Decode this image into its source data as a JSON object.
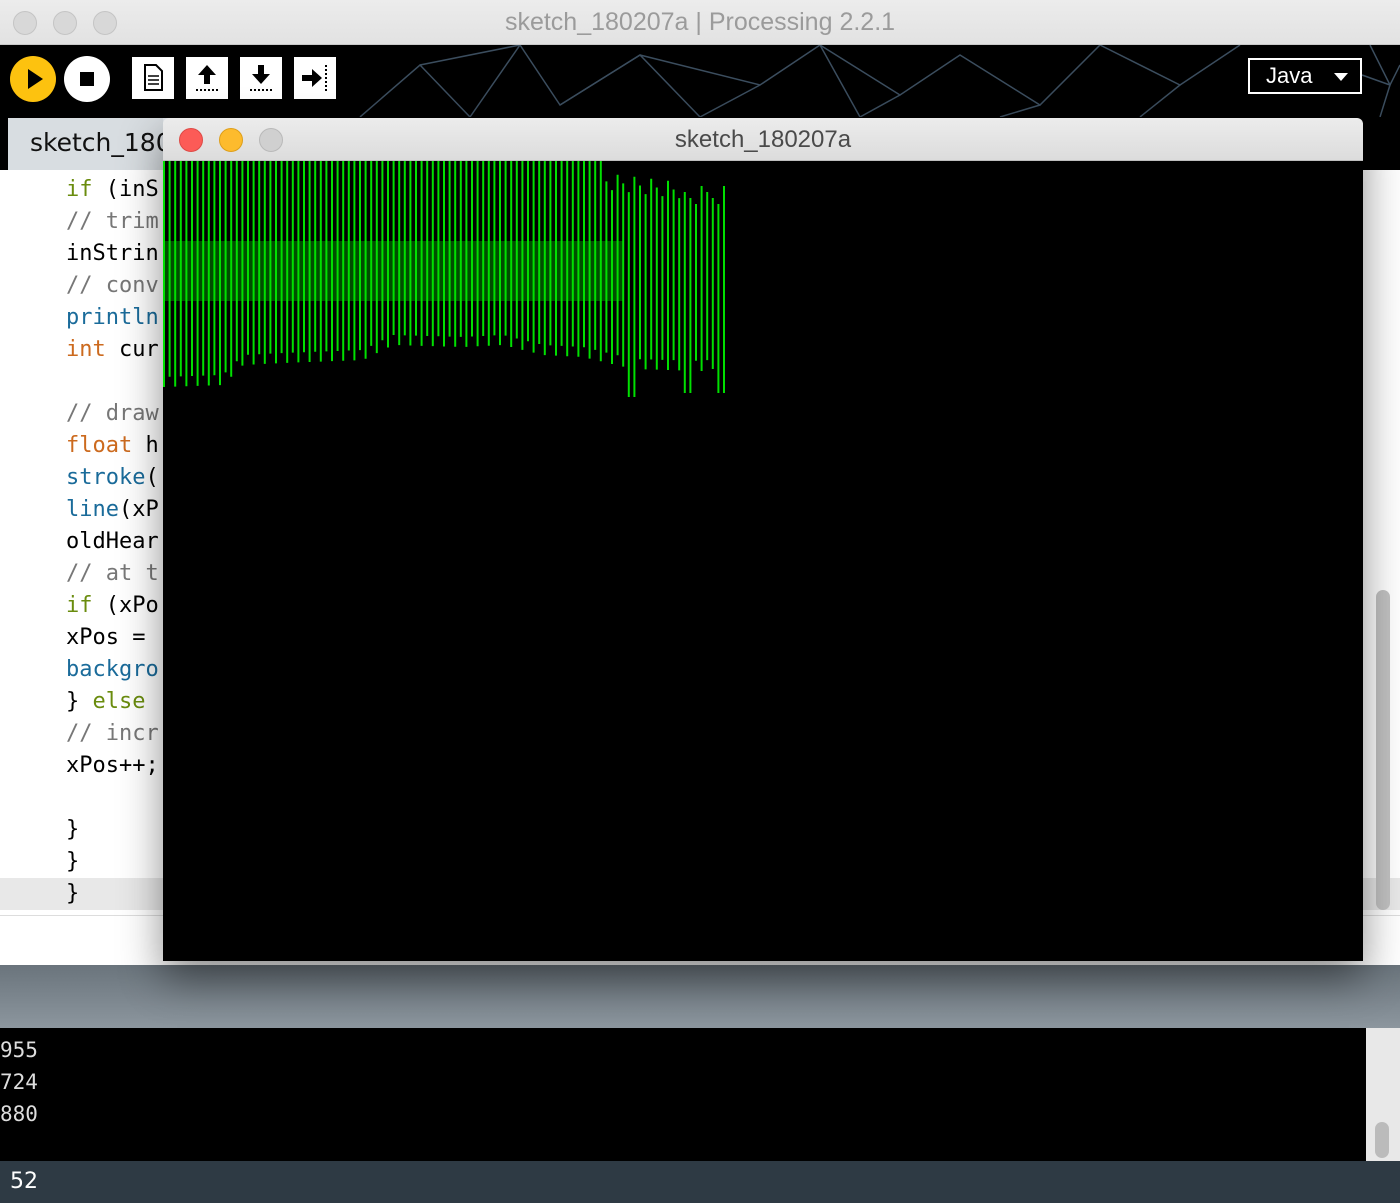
{
  "window": {
    "title": "sketch_180207a | Processing 2.2.1"
  },
  "toolbar": {
    "buttons": [
      {
        "name": "run-button",
        "icon": "play-icon"
      },
      {
        "name": "stop-button",
        "icon": "stop-icon"
      },
      {
        "name": "new-button",
        "icon": "new-file-icon"
      },
      {
        "name": "open-button",
        "icon": "upload-arrow-icon"
      },
      {
        "name": "save-button",
        "icon": "download-arrow-icon"
      },
      {
        "name": "export-button",
        "icon": "export-arrow-icon"
      }
    ],
    "mode_label": "Java",
    "run_color": "#fdc20f"
  },
  "tabs": [
    {
      "label": "sketch_180"
    }
  ],
  "editor": {
    "lines": [
      {
        "text": "if (inS",
        "kind": "mixed",
        "kw": "if",
        "rest": " (inS"
      },
      {
        "text": "// trim",
        "kind": "comment"
      },
      {
        "text": "inStrin",
        "kind": "plain"
      },
      {
        "text": "// conv",
        "kind": "comment"
      },
      {
        "text": "println",
        "kind": "blue"
      },
      {
        "text": "int cur",
        "kind": "mixed-orange",
        "kw": "int",
        "rest": " cur"
      },
      {
        "text": "",
        "kind": "plain"
      },
      {
        "text": "// draw",
        "kind": "comment"
      },
      {
        "text": "float h",
        "kind": "mixed-orange",
        "kw": "float",
        "rest": " h"
      },
      {
        "text": "stroke(",
        "kind": "mixed-blue",
        "kw": "stroke",
        "rest": "("
      },
      {
        "text": "line(xP",
        "kind": "mixed-blue",
        "kw": "line",
        "rest": "(xP"
      },
      {
        "text": "oldHear",
        "kind": "plain"
      },
      {
        "text": "// at t",
        "kind": "comment"
      },
      {
        "text": "if (xPo",
        "kind": "mixed",
        "kw": "if",
        "rest": " (xPo"
      },
      {
        "text": "xPos =",
        "kind": "plain"
      },
      {
        "text": "backgro",
        "kind": "blue"
      },
      {
        "text": "} else",
        "kind": "else"
      },
      {
        "text": "// incr",
        "kind": "comment"
      },
      {
        "text": "xPos++;",
        "kind": "plain"
      },
      {
        "text": "",
        "kind": "plain"
      },
      {
        "text": "}",
        "kind": "plain"
      },
      {
        "text": "}",
        "kind": "plain"
      },
      {
        "text": "}",
        "kind": "plain"
      }
    ]
  },
  "sketch": {
    "title": "sketch_180207a",
    "stroke_color": "#00e000",
    "background": "#000000"
  },
  "console": {
    "lines": [
      "955",
      "724",
      "880"
    ]
  },
  "status": {
    "line_number": "52"
  }
}
